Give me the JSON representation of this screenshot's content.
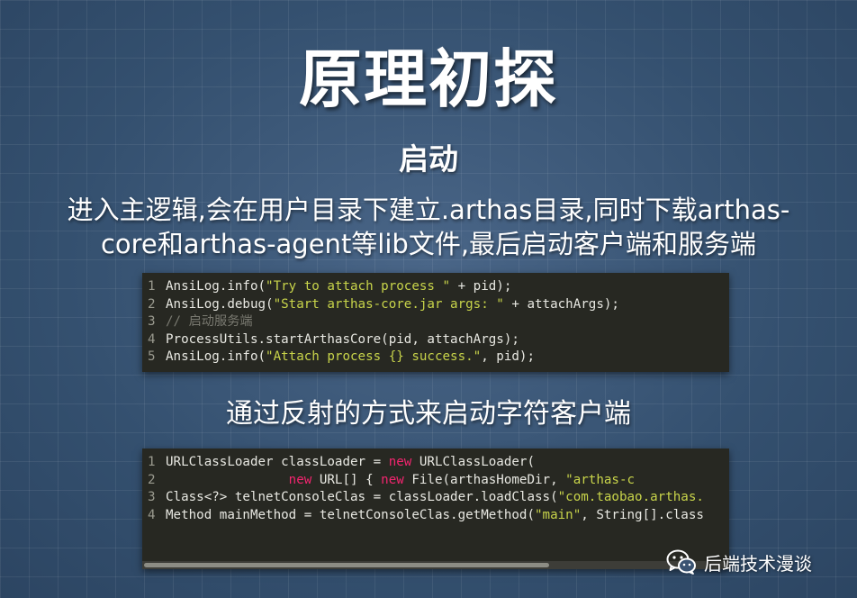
{
  "slide": {
    "title": "原理初探",
    "subtitle": "启动",
    "description_line1": "进入主逻辑,会在用户目录下建立.arthas目录,同时下载arthas-",
    "description_line2": "core和arthas-agent等lib文件,最后启动客户端和服务端",
    "section2_heading": "通过反射的方式来启动字符客户端"
  },
  "code_block_1": {
    "lines": [
      {
        "num": "1",
        "segments": [
          {
            "t": "AnsiLog.info(",
            "c": "plain"
          },
          {
            "t": "\"Try to attach process \"",
            "c": "str"
          },
          {
            "t": " + pid);",
            "c": "plain"
          }
        ]
      },
      {
        "num": "2",
        "segments": [
          {
            "t": "AnsiLog.debug(",
            "c": "plain"
          },
          {
            "t": "\"Start arthas-core.jar args: \"",
            "c": "str"
          },
          {
            "t": " + attachArgs);",
            "c": "plain"
          }
        ]
      },
      {
        "num": "3",
        "segments": [
          {
            "t": "// 启动服务端",
            "c": "cm"
          }
        ]
      },
      {
        "num": "4",
        "segments": [
          {
            "t": "ProcessUtils.startArthasCore(pid, attachArgs);",
            "c": "plain"
          }
        ]
      },
      {
        "num": "5",
        "segments": [
          {
            "t": "AnsiLog.info(",
            "c": "plain"
          },
          {
            "t": "\"Attach process {} success.\"",
            "c": "str"
          },
          {
            "t": ", pid);",
            "c": "plain"
          }
        ]
      }
    ]
  },
  "code_block_2": {
    "lines": [
      {
        "num": "1",
        "segments": [
          {
            "t": "URLClassLoader classLoader = ",
            "c": "plain"
          },
          {
            "t": "new",
            "c": "kw"
          },
          {
            "t": " URLClassLoader(",
            "c": "plain"
          }
        ]
      },
      {
        "num": "2",
        "segments": [
          {
            "t": "                new",
            "c": "kw"
          },
          {
            "t": " URL[] { ",
            "c": "plain"
          },
          {
            "t": "new",
            "c": "kw"
          },
          {
            "t": " File(arthasHomeDir, ",
            "c": "plain"
          },
          {
            "t": "\"arthas-c",
            "c": "str"
          }
        ]
      },
      {
        "num": "3",
        "segments": [
          {
            "t": "Class<?> telnetConsoleClas = classLoader.loadClass(",
            "c": "plain"
          },
          {
            "t": "\"com.taobao.arthas.",
            "c": "str"
          }
        ]
      },
      {
        "num": "4",
        "segments": [
          {
            "t": "Method mainMethod = telnetConsoleClas.getMethod(",
            "c": "plain"
          },
          {
            "t": "\"main\"",
            "c": "str"
          },
          {
            "t": ", String[].class",
            "c": "plain"
          }
        ]
      }
    ]
  },
  "watermark": {
    "icon": "wechat-icon",
    "label": "后端技术漫谈"
  }
}
